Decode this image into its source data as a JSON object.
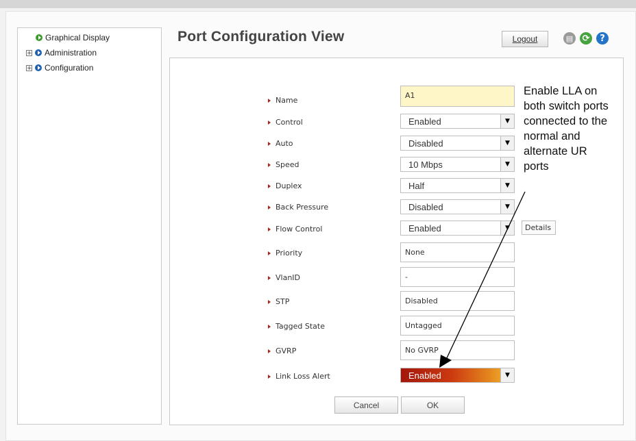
{
  "nav": {
    "items": [
      {
        "label": "Graphical Display",
        "expandable": false,
        "icon": "green-arrow-bullet-icon"
      },
      {
        "label": "Administration",
        "expandable": true,
        "icon": "blue-arrow-bullet-icon"
      },
      {
        "label": "Configuration",
        "expandable": true,
        "icon": "blue-arrow-bullet-icon"
      }
    ]
  },
  "header": {
    "title": "Port Configuration View",
    "logout_label": "Logout",
    "icons": [
      "save-icon",
      "refresh-icon",
      "help-icon"
    ]
  },
  "form": {
    "fields": [
      {
        "label": "Name",
        "value": "A1",
        "kind": "text-highlight"
      },
      {
        "label": "Control",
        "value": "Enabled",
        "kind": "select"
      },
      {
        "label": "Auto",
        "value": "Disabled",
        "kind": "select"
      },
      {
        "label": "Speed",
        "value": "10 Mbps",
        "kind": "select"
      },
      {
        "label": "Duplex",
        "value": "Half",
        "kind": "select"
      },
      {
        "label": "Back Pressure",
        "value": "Disabled",
        "kind": "select"
      },
      {
        "label": "Flow Control",
        "value": "Enabled",
        "kind": "select"
      },
      {
        "label": "Priority",
        "value": "None",
        "kind": "text"
      },
      {
        "label": "VlanID",
        "value": "-",
        "kind": "text"
      },
      {
        "label": "STP",
        "value": "Disabled",
        "kind": "text"
      },
      {
        "label": "Tagged State",
        "value": "Untagged",
        "kind": "text"
      },
      {
        "label": "GVRP",
        "value": "No GVRP",
        "kind": "text"
      },
      {
        "label": "Link Loss Alert",
        "value": "Enabled",
        "kind": "select-highlight"
      }
    ],
    "details_label": "Details",
    "cancel_label": "Cancel",
    "ok_label": "OK"
  },
  "annotation": {
    "lines": [
      "Enable LLA on",
      "both switch ports",
      "connected to the",
      "normal and",
      "alternate UR",
      "ports"
    ]
  },
  "colors": {
    "highlight_yellow": "#fff6c8",
    "alert_gradient_start": "#a3170c",
    "alert_gradient_end": "#f2c12e",
    "label_marker": "#b0201a"
  }
}
